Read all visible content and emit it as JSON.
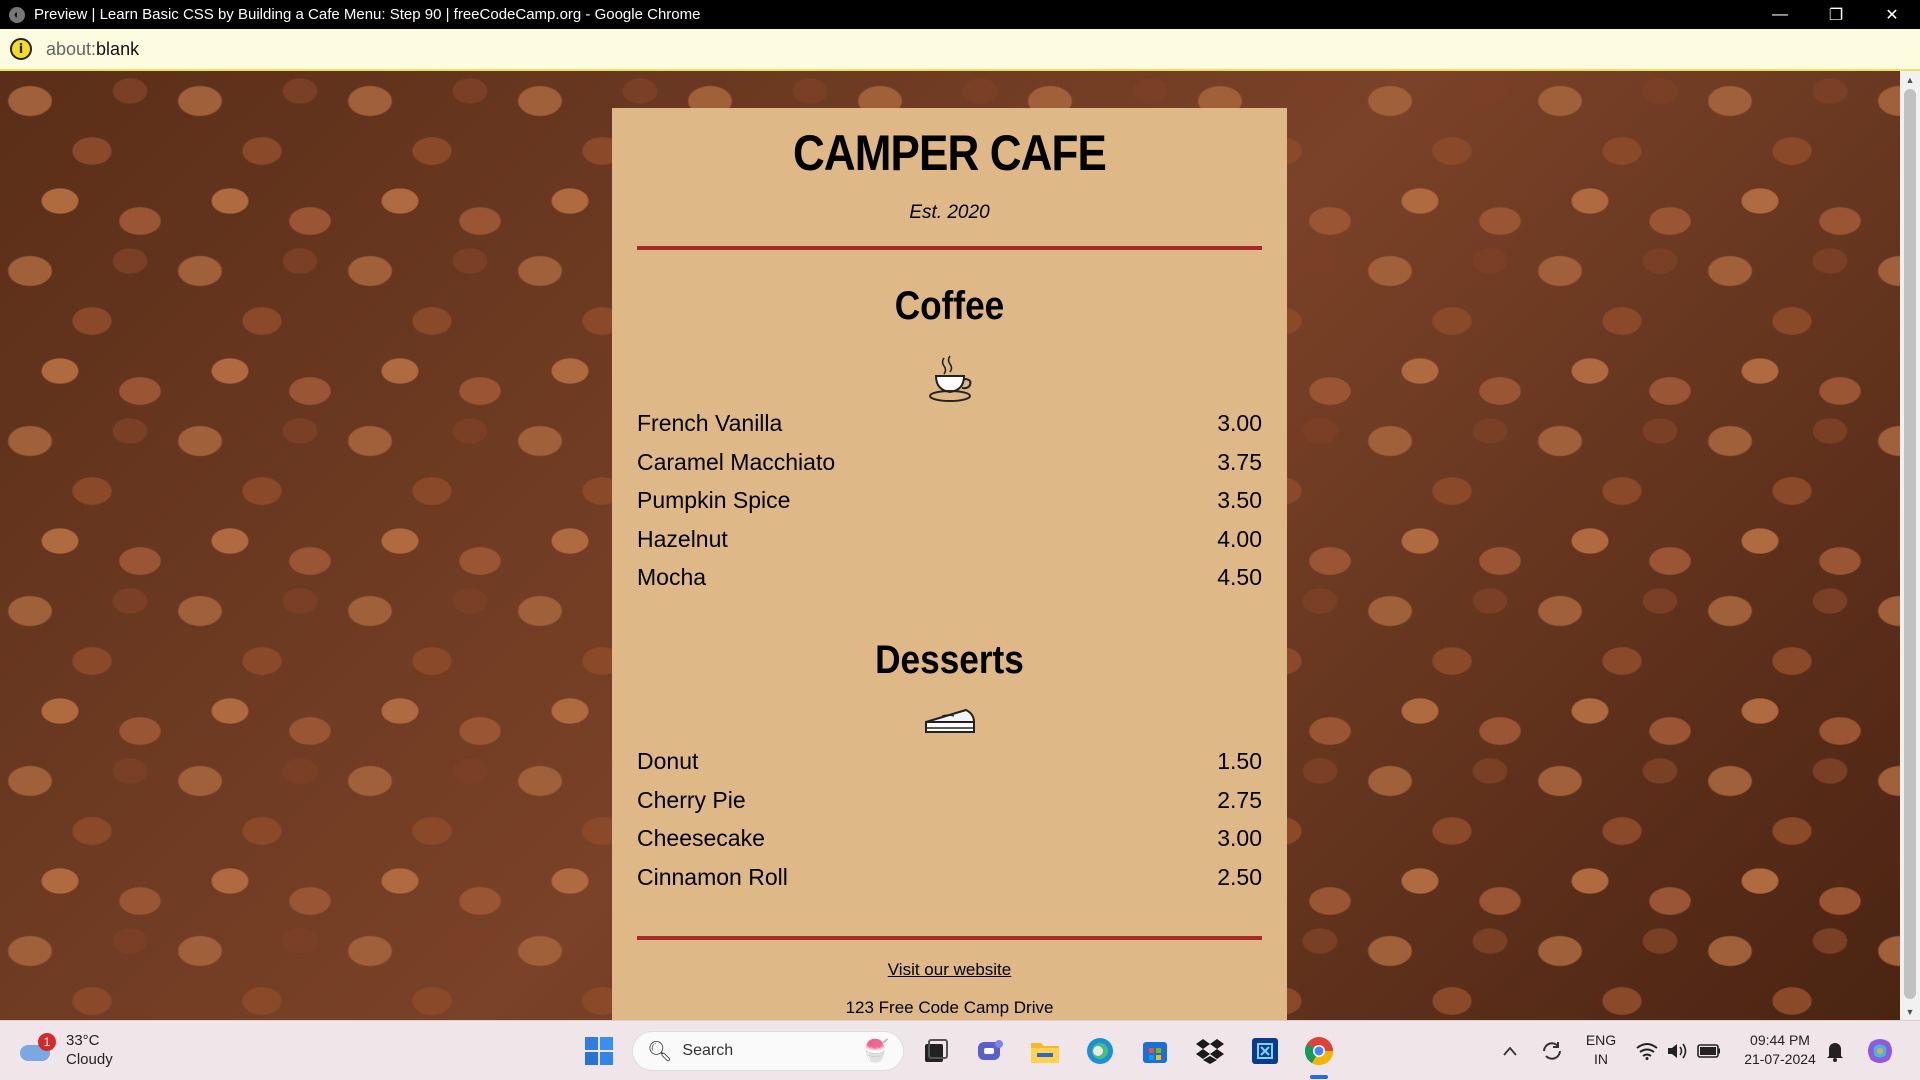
{
  "window": {
    "title": "Preview | Learn Basic CSS by Building a Cafe Menu: Step 90 | freeCodeCamp.org - Google Chrome",
    "minimize": "—",
    "restore": "❐",
    "close": "✕"
  },
  "address_bar": {
    "scheme": "about:",
    "path": "blank"
  },
  "menu": {
    "title": "CAMPER CAFE",
    "established": "Est. 2020",
    "sections": [
      {
        "heading": "Coffee",
        "icon": "coffee-cup-icon",
        "items": [
          {
            "name": "French Vanilla",
            "price": "3.00"
          },
          {
            "name": "Caramel Macchiato",
            "price": "3.75"
          },
          {
            "name": "Pumpkin Spice",
            "price": "3.50"
          },
          {
            "name": "Hazelnut",
            "price": "4.00"
          },
          {
            "name": "Mocha",
            "price": "4.50"
          }
        ]
      },
      {
        "heading": "Desserts",
        "icon": "pie-slice-icon",
        "items": [
          {
            "name": "Donut",
            "price": "1.50"
          },
          {
            "name": "Cherry Pie",
            "price": "2.75"
          },
          {
            "name": "Cheesecake",
            "price": "3.00"
          },
          {
            "name": "Cinnamon Roll",
            "price": "2.50"
          }
        ]
      }
    ],
    "website_link": "Visit our website",
    "address": "123 Free Code Camp Drive"
  },
  "taskbar": {
    "weather": {
      "temperature": "33°C",
      "condition": "Cloudy",
      "badge": "1"
    },
    "search_label": "Search",
    "language": {
      "line1": "ENG",
      "line2": "IN"
    },
    "clock": {
      "time": "09:44 PM",
      "date": "21-07-2024"
    },
    "pinned_apps": [
      "start-icon",
      "task-view-icon",
      "teams-icon",
      "file-explorer-icon",
      "edge-icon",
      "store-icon",
      "dropbox-icon",
      "app-icon",
      "chrome-icon"
    ]
  },
  "colors": {
    "card_background": "#deb887",
    "divider": "#a52a2a",
    "address_bar_background": "#fdfbe0"
  }
}
